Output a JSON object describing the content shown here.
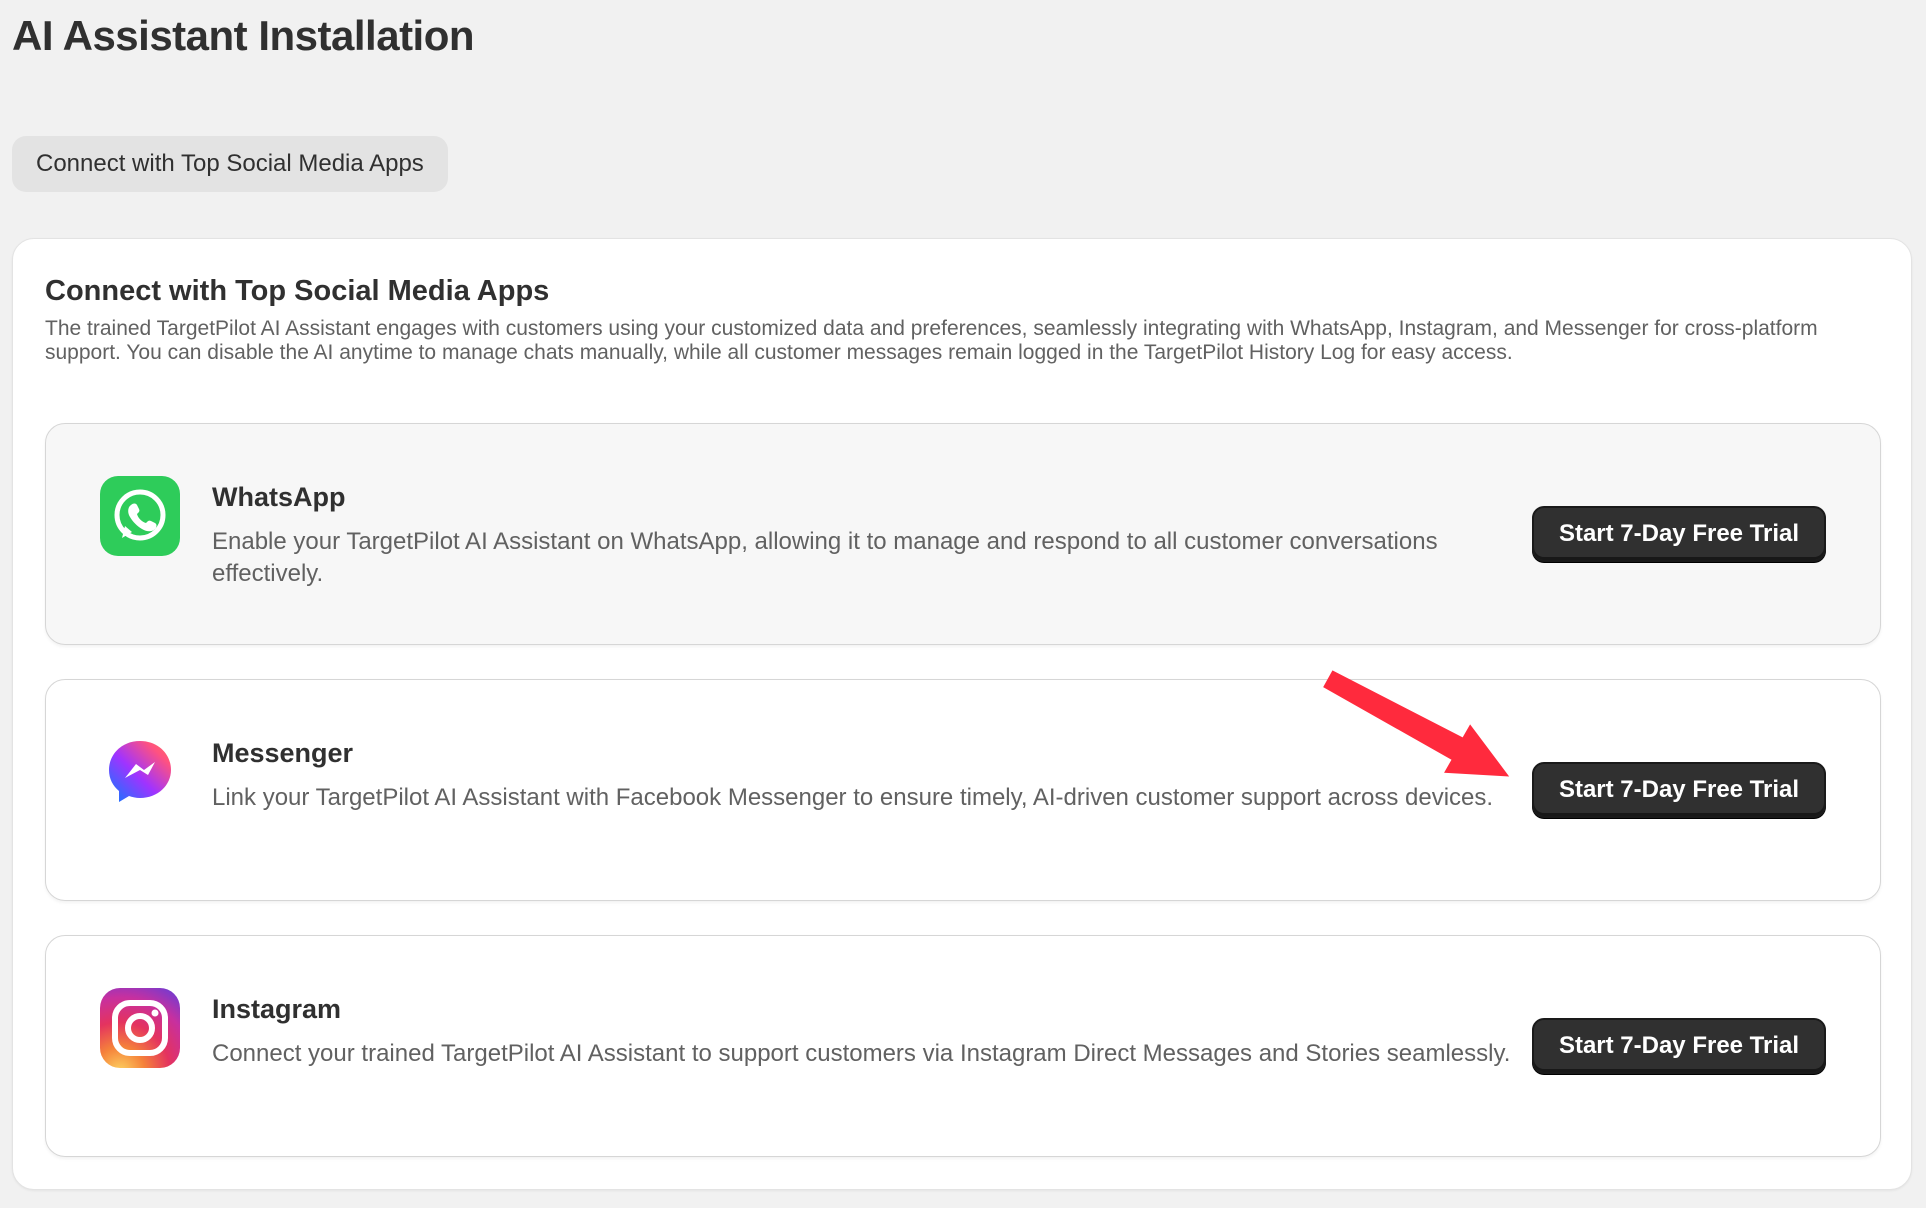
{
  "page": {
    "title": "AI Assistant Installation"
  },
  "tabs": [
    {
      "label": "Connect with Top Social Media Apps"
    }
  ],
  "section": {
    "title": "Connect with Top Social Media Apps",
    "description": "The trained TargetPilot AI Assistant engages with customers using your customized data and preferences, seamlessly integrating with WhatsApp, Instagram, and Messenger for cross-platform support. You can disable the AI anytime to manage chats manually, while all customer messages remain logged in the TargetPilot History Log for easy access."
  },
  "apps": [
    {
      "name": "WhatsApp",
      "icon": "whatsapp-icon",
      "description": "Enable your TargetPilot AI Assistant on WhatsApp, allowing it to manage and respond to all customer conversations effectively.",
      "button_label": "Start 7-Day Free Trial",
      "color": "#25D366"
    },
    {
      "name": "Messenger",
      "icon": "messenger-icon",
      "description": "Link your TargetPilot AI Assistant with Facebook Messenger to ensure timely, AI-driven customer support across devices.",
      "button_label": "Start 7-Day Free Trial",
      "color": "#A334FA"
    },
    {
      "name": "Instagram",
      "icon": "instagram-icon",
      "description": "Connect your trained TargetPilot AI Assistant to support customers via Instagram Direct Messages and Stories seamlessly.",
      "button_label": "Start 7-Day Free Trial",
      "color": "#E1306C"
    }
  ],
  "colors": {
    "background": "#f1f1f1",
    "card": "#ffffff",
    "button": "#303030",
    "annotation_arrow": "#ff2a3d"
  }
}
